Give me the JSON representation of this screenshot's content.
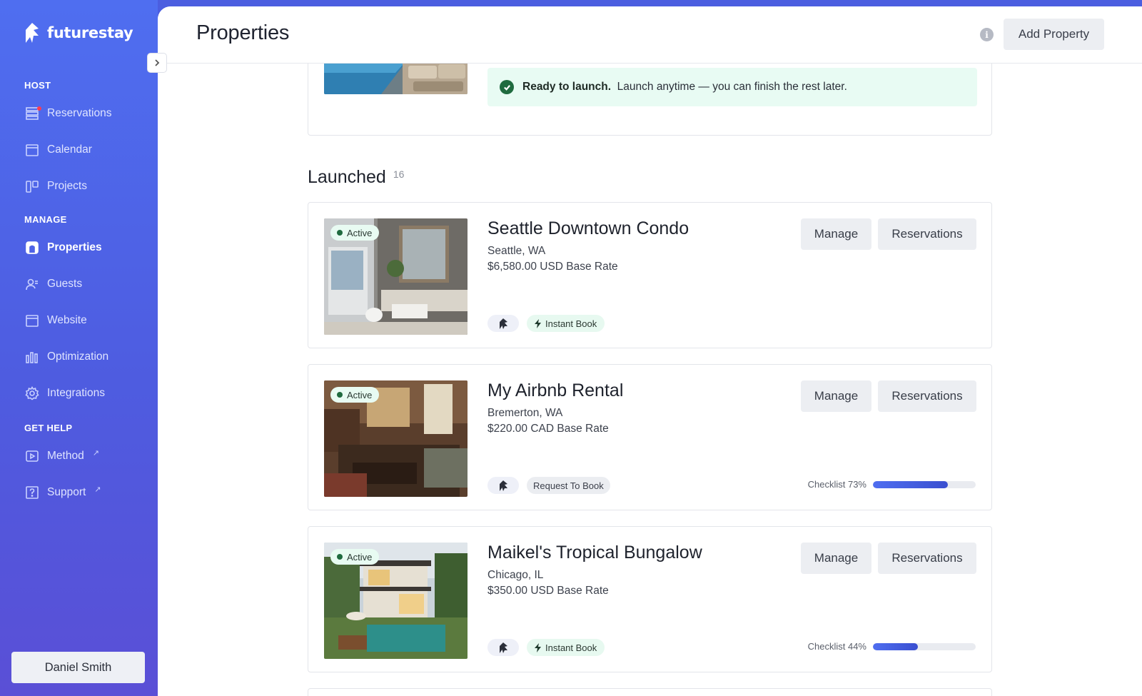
{
  "brand": {
    "name": "futurestay"
  },
  "sidebar": {
    "sections": [
      {
        "title": "HOST"
      },
      {
        "title": "MANAGE"
      },
      {
        "title": "GET HELP"
      }
    ],
    "items": [
      {
        "label": "Reservations",
        "icon": "reservations-icon",
        "badge": true
      },
      {
        "label": "Calendar",
        "icon": "calendar-icon"
      },
      {
        "label": "Projects",
        "icon": "projects-icon"
      },
      {
        "label": "Properties",
        "icon": "properties-icon",
        "active": true
      },
      {
        "label": "Guests",
        "icon": "guests-icon"
      },
      {
        "label": "Website",
        "icon": "website-icon"
      },
      {
        "label": "Optimization",
        "icon": "optimization-icon"
      },
      {
        "label": "Integrations",
        "icon": "integrations-icon"
      },
      {
        "label": "Method",
        "icon": "video-icon",
        "external": "↗"
      },
      {
        "label": "Support",
        "icon": "help-icon",
        "external": "↗"
      }
    ],
    "user": "Daniel Smith"
  },
  "header": {
    "title": "Properties",
    "add_button": "Add Property",
    "info_icon": "i"
  },
  "draft_card": {
    "ready_bold": "Ready to launch.",
    "ready_text": "Launch anytime — you can finish the rest later."
  },
  "launched": {
    "title": "Launched",
    "count": "16",
    "properties": [
      {
        "name": "Seattle Downtown Condo",
        "location": "Seattle, WA",
        "rate": "$6,580.00 USD Base Rate",
        "status": "Active",
        "booking": "Instant Book",
        "manage": "Manage",
        "reservations": "Reservations"
      },
      {
        "name": "My Airbnb Rental",
        "location": "Bremerton, WA",
        "rate": "$220.00 CAD Base Rate",
        "status": "Active",
        "booking": "Request To Book",
        "checklist_label": "Checklist 73%",
        "checklist_value": 73,
        "manage": "Manage",
        "reservations": "Reservations"
      },
      {
        "name": "Maikel's Tropical Bungalow",
        "location": "Chicago, IL",
        "rate": "$350.00 USD Base Rate",
        "status": "Active",
        "booking": "Instant Book",
        "checklist_label": "Checklist 44%",
        "checklist_value": 44,
        "manage": "Manage",
        "reservations": "Reservations"
      }
    ]
  },
  "colors": {
    "sidebar_bg": "#4f6ef0",
    "accent": "#3f55d8",
    "success": "#1f6b3f",
    "success_bg": "#e8fbf3",
    "notification": "#ff3b4f"
  }
}
